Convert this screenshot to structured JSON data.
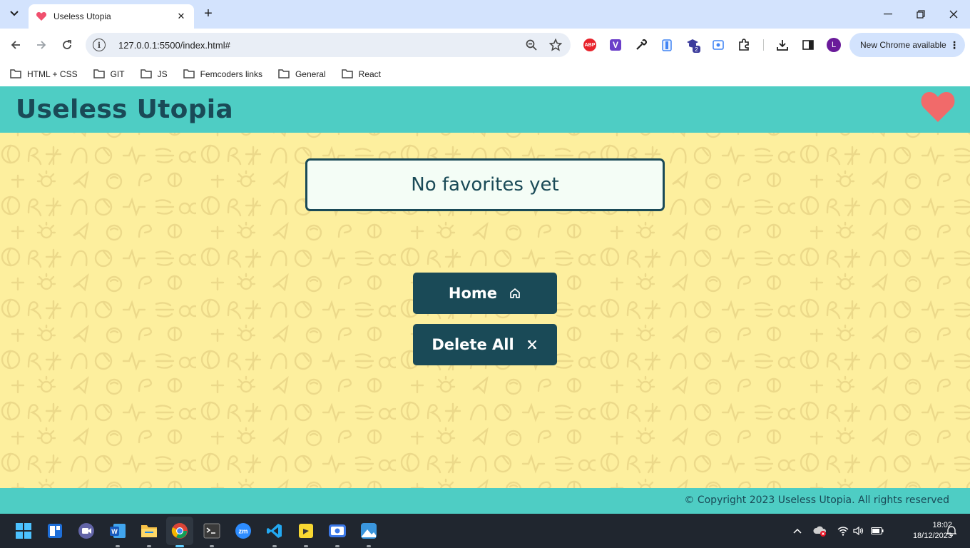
{
  "browser": {
    "tab": {
      "title": "Useless Utopia"
    },
    "url": "127.0.0.1:5500/index.html#",
    "update_label": "New Chrome available",
    "profile_initial": "L",
    "extension_badge": "2",
    "abp_label": "ABP",
    "v_label": "V"
  },
  "bookmarks": [
    {
      "label": "HTML + CSS"
    },
    {
      "label": "GIT"
    },
    {
      "label": "JS"
    },
    {
      "label": "Femcoders links"
    },
    {
      "label": "General"
    },
    {
      "label": "React"
    }
  ],
  "site": {
    "title": "Useless Utopia",
    "empty_message": "No favorites yet",
    "home_label": "Home",
    "delete_label": "Delete All",
    "footer": "© Copyright 2023 Useless Utopia. All rights reserved"
  },
  "taskbar": {
    "time": "18:02",
    "date": "18/12/2023",
    "zoom_label": "zm"
  },
  "colors": {
    "header": "#4ecdc4",
    "background": "#fdef9e",
    "primary": "#1a4a57",
    "heart": "#f16a6a"
  }
}
